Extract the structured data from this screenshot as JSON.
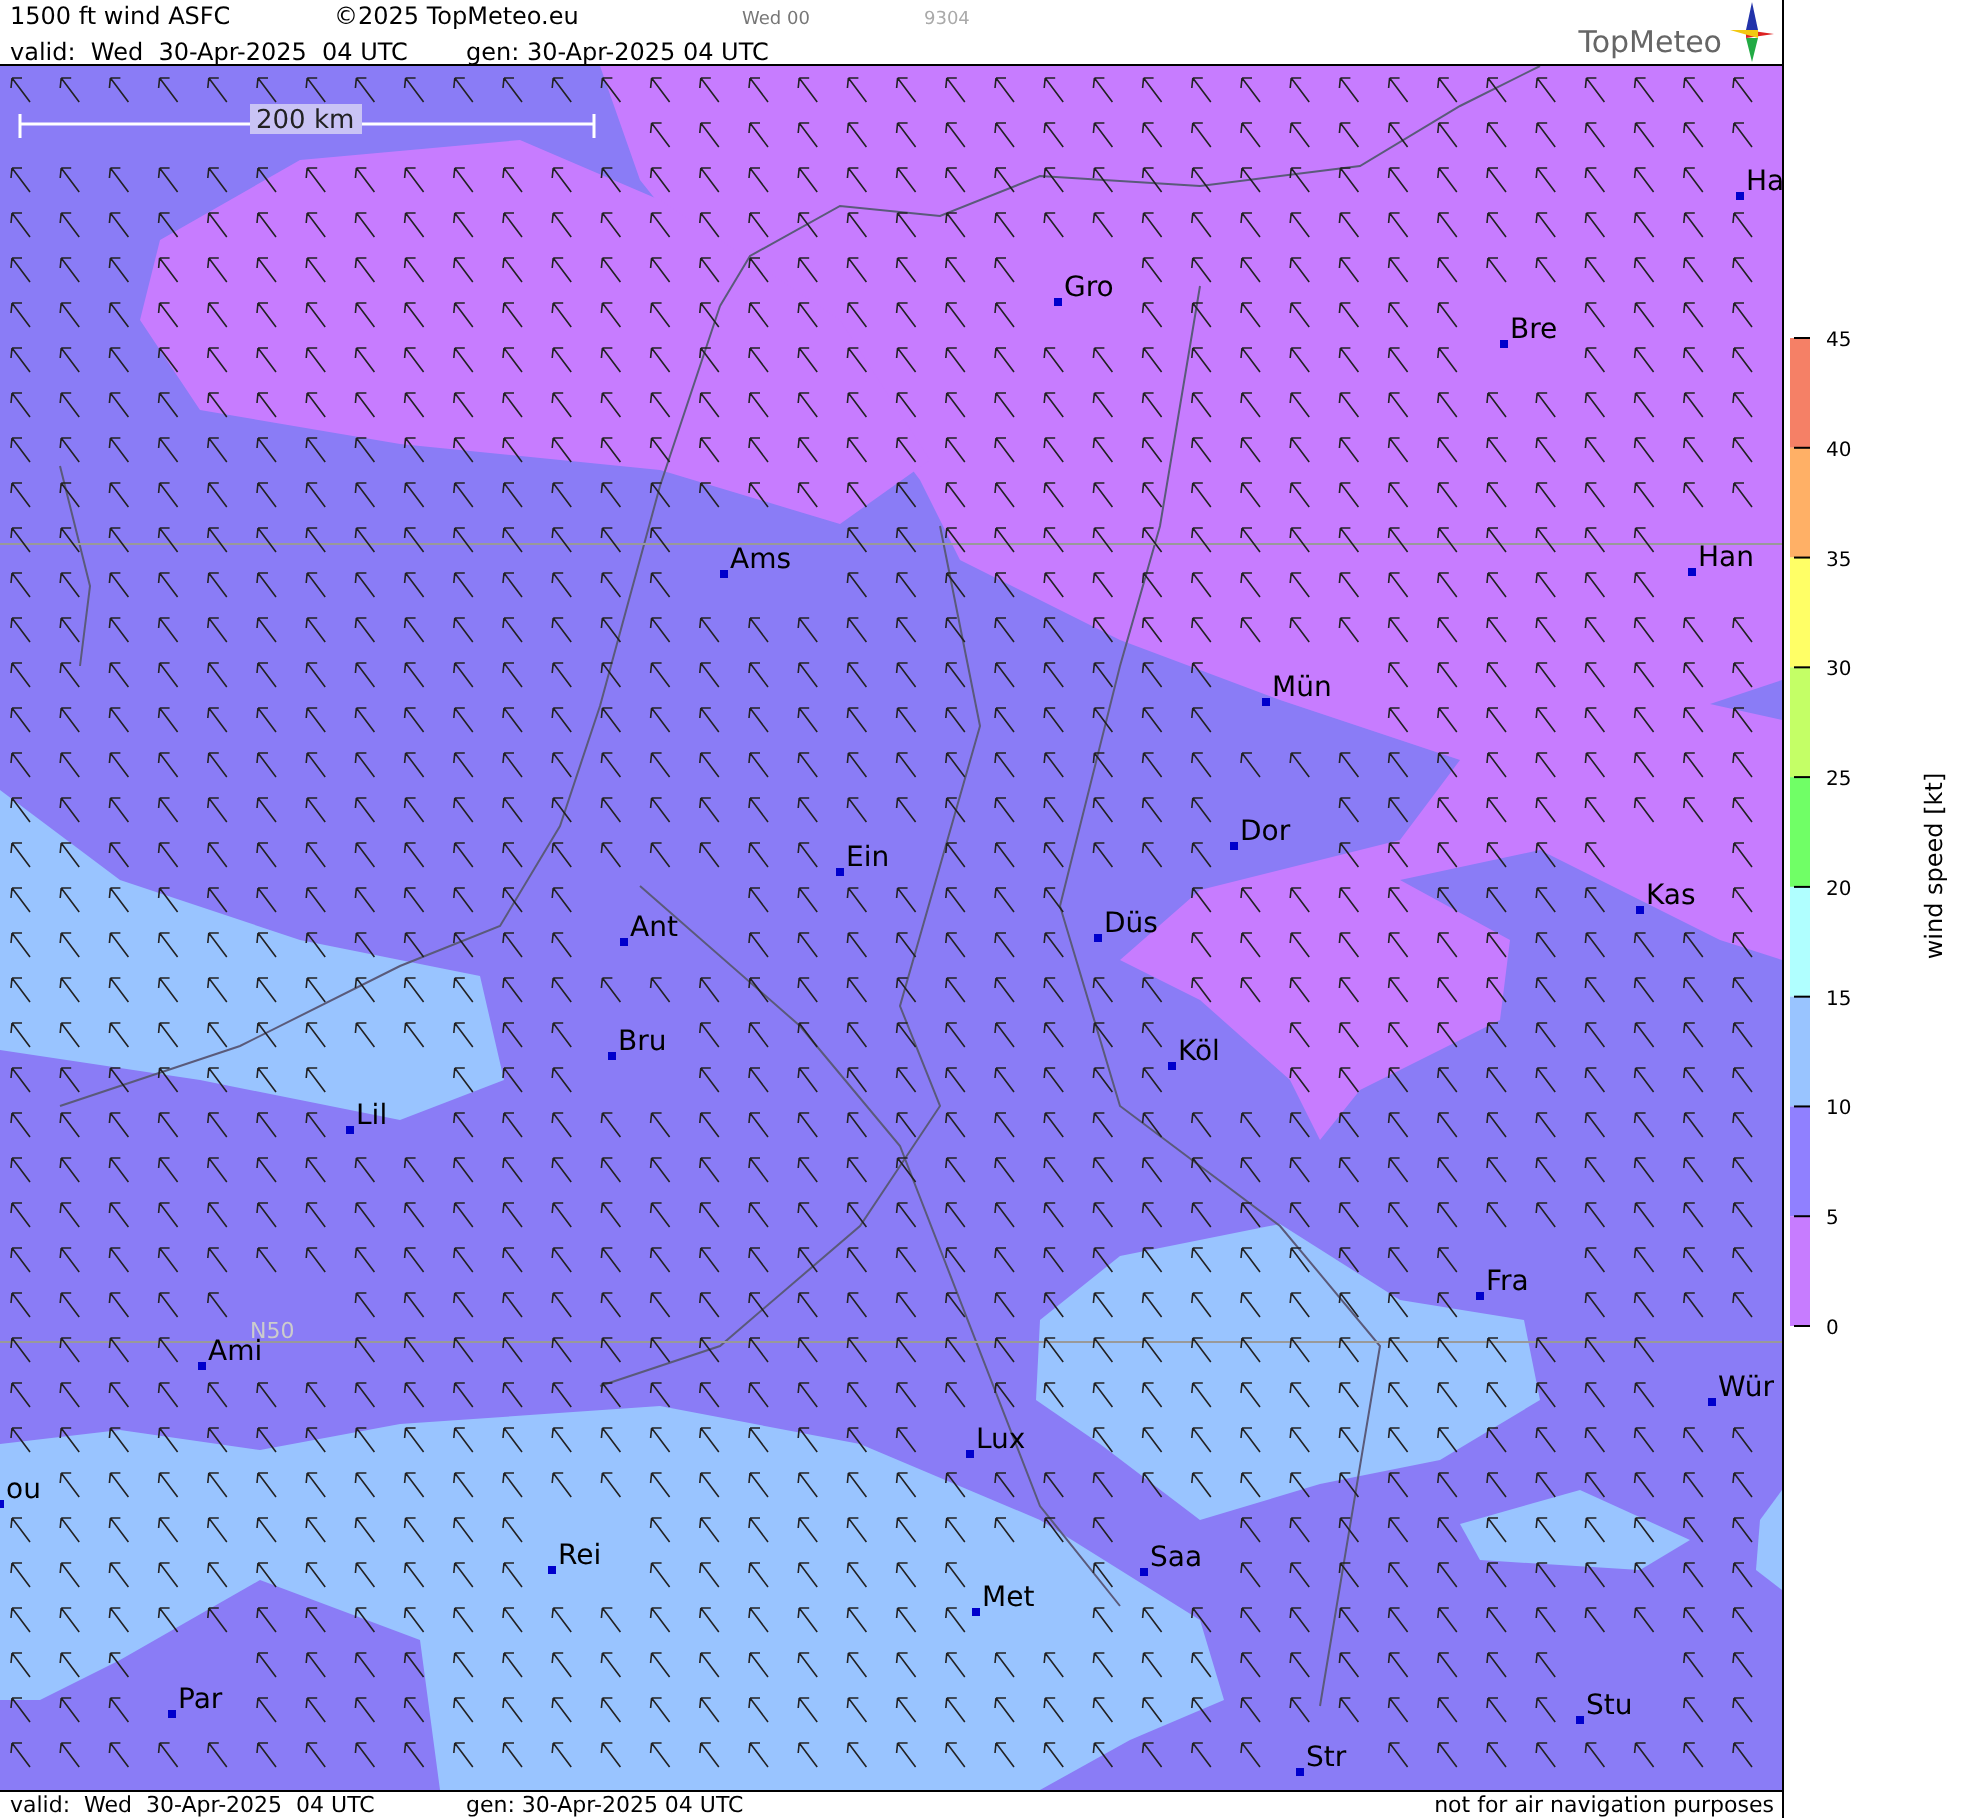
{
  "header": {
    "title": "1500 ft wind ASFC",
    "copyright": "©2025 TopMeteo.eu",
    "run": "Wed 00",
    "code": "9304",
    "valid": "valid:  Wed  30-Apr-2025  04 UTC",
    "generated": "gen: 30-Apr-2025 04 UTC",
    "logo": "TopMeteo"
  },
  "map": {
    "scale_bar": "200 km",
    "grid_label": "N50",
    "cities": [
      {
        "name": "Ha"
      },
      {
        "name": "Gro"
      },
      {
        "name": "Bre"
      },
      {
        "name": "Ams"
      },
      {
        "name": "Han"
      },
      {
        "name": "Mün"
      },
      {
        "name": "Dor"
      },
      {
        "name": "Ein"
      },
      {
        "name": "Kas"
      },
      {
        "name": "Düs"
      },
      {
        "name": "Ant"
      },
      {
        "name": "Bru"
      },
      {
        "name": "Köl"
      },
      {
        "name": "Lil"
      },
      {
        "name": "Fra"
      },
      {
        "name": "Ami"
      },
      {
        "name": "Wür"
      },
      {
        "name": "Lux"
      },
      {
        "name": "ou"
      },
      {
        "name": "Rei"
      },
      {
        "name": "Saa"
      },
      {
        "name": "Met"
      },
      {
        "name": "Par"
      },
      {
        "name": "Stu"
      },
      {
        "name": "Str"
      }
    ]
  },
  "legend": {
    "title": "wind speed [kt]",
    "ticks": [
      "45",
      "40",
      "35",
      "30",
      "25",
      "20",
      "15",
      "10",
      "5",
      "0"
    ],
    "bands": [
      {
        "color": "#f58066"
      },
      {
        "color": "#ffb066"
      },
      {
        "color": "#ffff66"
      },
      {
        "color": "#c4ff66"
      },
      {
        "color": "#70ff66"
      },
      {
        "color": "#b0ffff"
      },
      {
        "color": "#99c4ff"
      },
      {
        "color": "#9080ff"
      },
      {
        "color": "#c77cff"
      }
    ]
  },
  "footer": {
    "valid": "valid:  Wed  30-Apr-2025  04 UTC",
    "generated": "gen: 30-Apr-2025 04 UTC",
    "disclaimer": "not for air navigation purposes"
  }
}
